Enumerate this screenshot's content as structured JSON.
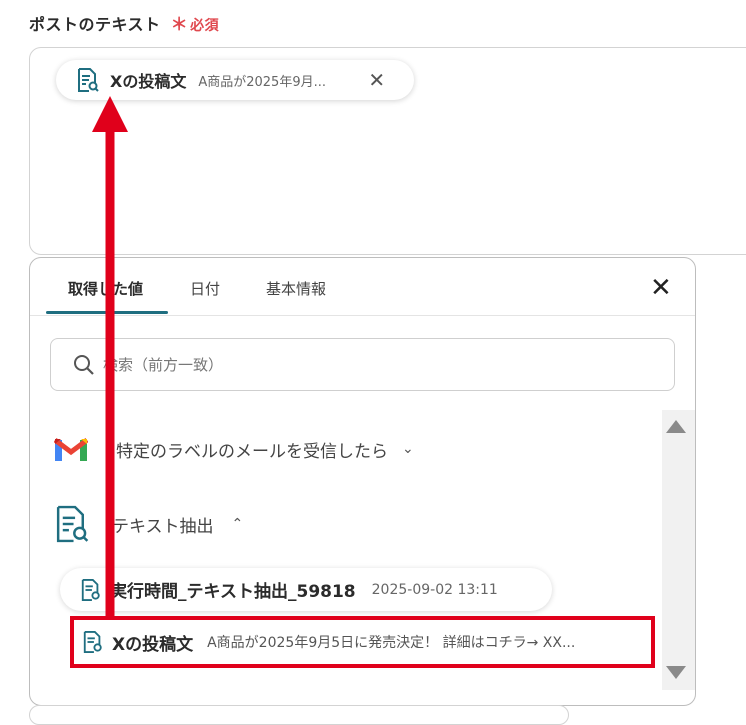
{
  "field": {
    "label": "ポストのテキスト",
    "required_mark": "＊",
    "required_text": "必須"
  },
  "chip": {
    "title": "Xの投稿文",
    "value": "A商品が2025年9月...",
    "icon": "document-search-icon",
    "remove_icon": "close-icon"
  },
  "panel": {
    "tabs": [
      {
        "label": "取得した値"
      },
      {
        "label": "日付"
      },
      {
        "label": "基本情報"
      }
    ],
    "active_tab": 0,
    "close_icon": "close-icon",
    "search": {
      "placeholder": "検索（前方一致）",
      "icon": "search-icon"
    },
    "groups": [
      {
        "label": "特定のラベルのメールを受信したら",
        "icon": "gmail-icon",
        "expanded": false
      },
      {
        "label": "テキスト抽出",
        "icon": "document-search-icon",
        "expanded": true
      }
    ],
    "items": [
      {
        "title": "実行時間_テキスト抽出_59818",
        "value": "2025-09-02 13:11"
      },
      {
        "title": "Xの投稿文",
        "value": "A商品が2025年9月5日に発売決定！ 詳細はコチラ→ XX..."
      }
    ]
  },
  "colors": {
    "accent": "#1f6e80",
    "required": "#e0484e",
    "annotation": "#e0001b"
  }
}
